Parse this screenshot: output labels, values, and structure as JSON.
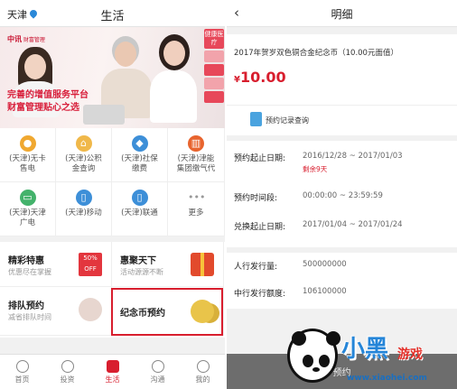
{
  "left": {
    "header": {
      "city": "天津",
      "title": "生活"
    },
    "banner": {
      "logo_small": "中讯",
      "logo_text": "财富管理",
      "line1": "完善的增值服务平台",
      "line2": "财富管理贴心之选",
      "side_tags": [
        "健康医疗",
        "",
        "",
        "",
        ""
      ]
    },
    "grid": [
      {
        "l1": "(天津)无卡",
        "l2": "售电",
        "icon": "bulb-icon",
        "color": "#f0a830"
      },
      {
        "l1": "(天津)公积",
        "l2": "金查询",
        "icon": "house-icon",
        "color": "#f0b84a"
      },
      {
        "l1": "(天津)社保",
        "l2": "缴费",
        "icon": "shield-icon",
        "color": "#3d8fd8"
      },
      {
        "l1": "(天津)津能",
        "l2": "集团缴气代",
        "icon": "heater-icon",
        "color": "#e8642e"
      },
      {
        "l1": "(天津)天津",
        "l2": "广电",
        "icon": "tv-icon",
        "color": "#43b26b"
      },
      {
        "l1": "(天津)移动",
        "l2": "",
        "icon": "phone-icon",
        "color": "#3d8fd8"
      },
      {
        "l1": "(天津)联通",
        "l2": "",
        "icon": "phone-icon",
        "color": "#3d8fd8"
      },
      {
        "l1": "更多",
        "l2": "",
        "icon": "more-icon",
        "color": "#999999"
      }
    ],
    "promos": [
      {
        "title": "精彩特惠",
        "sub": "优惠尽在掌握",
        "img_text": "50% OFF"
      },
      {
        "title": "惠聚天下",
        "sub": "活动源源不断",
        "img_text": ""
      },
      {
        "title": "排队预约",
        "sub": "减省排队时间",
        "img_text": ""
      },
      {
        "title": "纪念币预约",
        "sub": "",
        "img_text": ""
      }
    ],
    "footer": [
      "首页",
      "投资",
      "生活",
      "沟通",
      "我的"
    ],
    "footer_active": 2
  },
  "right": {
    "header": {
      "back": "‹",
      "title": "明细"
    },
    "coin_name": "2017年贺岁双色铜合金纪念币（10.00元面值）",
    "price_symbol": "¥",
    "price": "10.00",
    "query_label": "预约记录查询",
    "rows": [
      {
        "label": "预约起止日期:",
        "value": "2016/12/28 ~ 2017/01/03",
        "note": "剩余9天"
      },
      {
        "label": "预约时间段:",
        "value": "00:00:00 ~ 23:59:59"
      },
      {
        "label": "兑换起止日期:",
        "value": "2017/01/04 ~ 2017/01/24"
      }
    ],
    "rows2": [
      {
        "label": "人行发行量:",
        "value": "500000000"
      },
      {
        "label": "中行发行额度:",
        "value": "106100000"
      }
    ],
    "button_label": "预约"
  },
  "watermark": {
    "title": "小黑",
    "game": "游戏",
    "url": "www.xiaohei.com"
  }
}
